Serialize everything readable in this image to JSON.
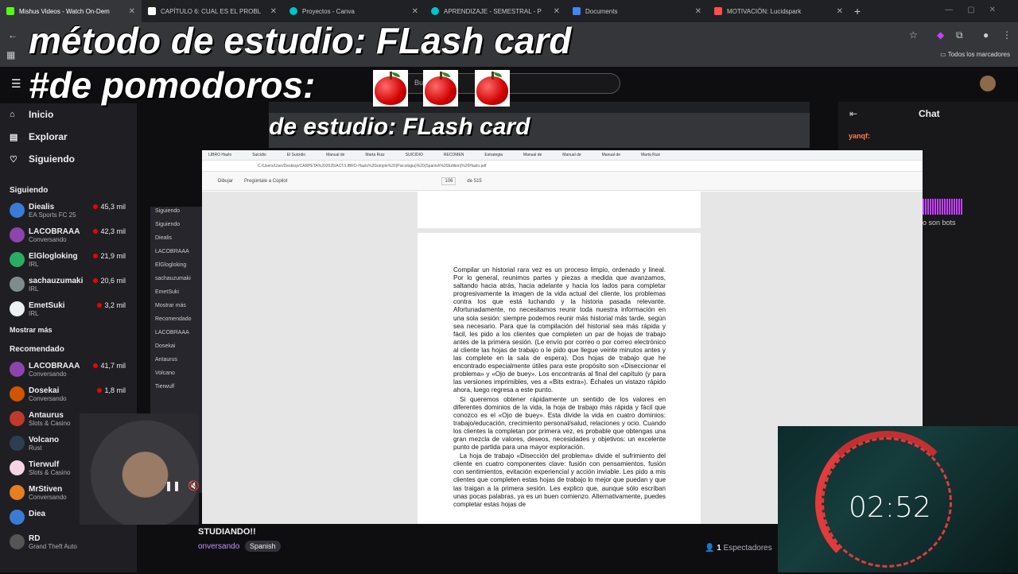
{
  "browser": {
    "tabs": [
      {
        "label": "Mishus Videos - Watch On-Dem",
        "color": "#53fc18",
        "active": true
      },
      {
        "label": "CAPÍTULO 6: CUAL ES EL PROBL",
        "color": "#ffffff",
        "active": false
      },
      {
        "label": "Proyectos - Canva",
        "color": "#00c4cc",
        "active": false
      },
      {
        "label": "APRENDIZAJE - SEMESTRAL - P",
        "color": "#00c4cc",
        "active": false
      },
      {
        "label": "Documents",
        "color": "#4285f4",
        "active": false
      },
      {
        "label": "MOTIVACIÓN: Lucidspark",
        "color": "#ff4d4d",
        "active": false
      }
    ],
    "bookmarks_label": "Todos los marcadores"
  },
  "overlay": {
    "line1": "método de estudio: FLash card",
    "line2": "#de pomodoros:",
    "nested_line": "de estudio: FLash card"
  },
  "search": {
    "placeholder": "Bu"
  },
  "sidenav": {
    "items": [
      {
        "label": "Inicio",
        "icon": "home-icon"
      },
      {
        "label": "Explorar",
        "icon": "compass-icon"
      },
      {
        "label": "Siguiendo",
        "icon": "heart-icon"
      }
    ],
    "following_heading": "Siguiendo",
    "following": [
      {
        "name": "Diealis",
        "game": "EA Sports FC 25",
        "viewers": "45,3 mil",
        "color": "#3a7bd5"
      },
      {
        "name": "LACOBRAAA",
        "game": "Conversando",
        "viewers": "42,3 mil",
        "color": "#8e44ad"
      },
      {
        "name": "ElGlogloking",
        "game": "IRL",
        "viewers": "21,9 mil",
        "color": "#27ae60"
      },
      {
        "name": "sachauzumaki",
        "game": "IRL",
        "viewers": "20,6 mil",
        "color": "#7f8c8d"
      },
      {
        "name": "EmetSuki",
        "game": "IRL",
        "viewers": "3,2 mil",
        "color": "#ecf0f1"
      }
    ],
    "show_more": "Mostrar más",
    "recommended_heading": "Recomendado",
    "recommended": [
      {
        "name": "LACOBRAAA",
        "game": "Conversando",
        "viewers": "41,7 mil",
        "color": "#8e44ad"
      },
      {
        "name": "Dosekai",
        "game": "Conversando",
        "viewers": "1,8 mil",
        "color": "#d35400"
      },
      {
        "name": "Antaurus",
        "game": "Slots & Casino",
        "viewers": "",
        "color": "#c0392b"
      },
      {
        "name": "Volcano",
        "game": "Rust",
        "viewers": "",
        "color": "#2c3e50"
      },
      {
        "name": "Tierwulf",
        "game": "Slots & Casino",
        "viewers": "",
        "color": "#f5d5e5"
      },
      {
        "name": "MrStiven",
        "game": "Conversando",
        "viewers": "",
        "color": "#e67e22"
      },
      {
        "name": "Diea",
        "game": "",
        "viewers": "",
        "color": "#3a7bd5"
      },
      {
        "name": "RD",
        "game": "Grand Theft Auto",
        "viewers": "",
        "color": "#555"
      }
    ]
  },
  "thumb_list": [
    "Siguiendo",
    "Siguiendo",
    "Diealis",
    "LACOBRAAA",
    "ElGlogloking",
    "sachauzumaki",
    "EmetSuki",
    "Mostrar más",
    "Recomendado",
    "LACOBRAAA",
    "Dosekai",
    "Antaurus",
    "Volcano",
    "Tierwulf"
  ],
  "pdf": {
    "tabs": [
      "LIBRO Hazlo",
      "Suicidio",
      "El Suicidio",
      "Manual de",
      "Marta Ruiz",
      "SUICIDIO",
      "RECOMEN",
      "Estrategia",
      "Manual de",
      "Manual de",
      "Manual de",
      "Marta Ruiz"
    ],
    "address": "C:/Users/User/Desktop/CARPETA%202025/ACT/LIBRO-Hazlo%20simple%20(Psicologia)%20(Spanish%20Edition)%20Hazlo.pdf",
    "tools": [
      "Dibujar",
      "Pregúntale a Copilot",
      "106",
      "de 515"
    ],
    "paragraphs": [
      "Compilar un historial rara vez es un proceso limpio, ordenado y lineal. Por lo general, reunimos partes y piezas a medida que avanzamos, saltando hacia atrás, hacia adelante y hacia los lados para completar progresivamente la imagen de la vida actual del cliente, los problemas contra los que está luchando y la historia pasada relevante. Afortunadamente, no necesitamos reunir toda nuestra información en una sola sesión: siempre podemos reunir más historial más tarde, según sea necesario. Para que la compilación del historial sea más rápida y fácil, les pido a los clientes que completen un par de hojas de trabajo antes de la primera sesión. (Le envío por correo o por correo electrónico al cliente las hojas de trabajo o le pido que llegue veinte minutos antes y las complete en la sala de espera). Dos hojas de trabajo que he encontrado especialmente útiles para este propósito son «Diseccionar el problema» y «Ojo de buey». Los encontrarás al final del capítulo (y para las versiones imprimibles, ves a «Bits extra»). Échales un vistazo rápido ahora, luego regresa a este punto.",
      "Si queremos obtener rápidamente un sentido de los valores en diferentes dominios de la vida, la hoja de trabajo más rápida y fácil que conozco es el «Ojo de buey». Esta divide la vida en cuatro dominios: trabajo/educación, crecimiento personal/salud, relaciones y ocio. Cuando los clientes la completan por primera vez, es probable que obtengas una gran mezcla de valores, deseos, necesidades y objetivos: un excelente punto de partida para una mayor exploración.",
      "La hoja de trabajo «Disección del problema» divide el sufrimiento del cliente en cuatro componentes clave: fusión con pensamientos, fusión con sentimientos, evitación experiencial y acción inviable. Les pido a mis clientes que completen estas hojas de trabajo lo mejor que puedan y que las traigan a la primera sesión. Les explico que, aunque sólo escriban unas pocas palabras, ya es un buen comienzo. Alternativamente, puedes completar estas hojas de"
    ]
  },
  "chat": {
    "title": "Chat",
    "user": "yanqf:",
    "message": "o son bots"
  },
  "stream": {
    "title": "STUDIANDO!!",
    "category": "onversando",
    "tag": "Spanish",
    "viewers_count": "1",
    "viewers_label": "Espectadores"
  },
  "timer": {
    "value": "02:52",
    "ring_color": "#e23b3b"
  }
}
